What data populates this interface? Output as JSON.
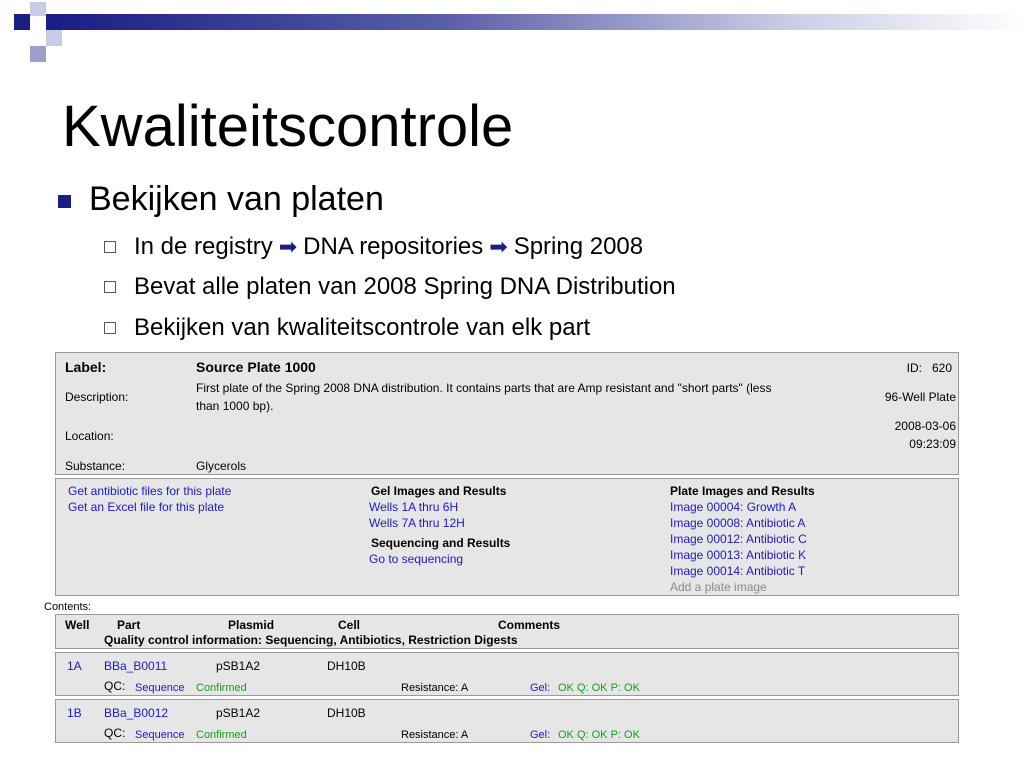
{
  "slide": {
    "title": "Kwaliteitscontrole",
    "bullet1": "Bekijken van platen",
    "sub1": {
      "part1": "In de registry",
      "part2": "DNA repositories",
      "part3": "Spring 2008"
    },
    "sub2": "Bevat alle platen van 2008 Spring DNA Distribution",
    "sub3": "Bekijken van kwaliteitscontrole van elk part",
    "arrow": "➡"
  },
  "plate": {
    "label_key": "Label:",
    "label_value": "Source Plate 1000",
    "id_text": "ID:   620",
    "description_key": "Description:",
    "description_line1": "First plate of the Spring 2008 DNA distribution. It contains parts that are Amp resistant and \"short parts\" (less",
    "description_line2": "than 1000 bp).",
    "plate_type": "96-Well Plate",
    "location_key": "Location:",
    "date": "2008-03-06",
    "time": "09:23:09",
    "substance_key": "Substance:",
    "substance_value": "Glycerols"
  },
  "files": {
    "antibiotic_link": "Get antibiotic files for this plate",
    "excel_link": "Get an Excel file for this plate",
    "gel_heading": "Gel Images and Results",
    "gel_links": [
      "Wells 1A thru 6H",
      "Wells 7A thru 12H"
    ],
    "seq_heading": "Sequencing and Results",
    "seq_link": "Go to sequencing",
    "img_heading": "Plate Images and Results",
    "img_links": [
      "Image 00004: Growth A",
      "Image 00008: Antibiotic A",
      "Image 00012: Antibiotic C",
      "Image 00013: Antibiotic K",
      "Image 00014: Antibiotic T"
    ],
    "add_image": "Add a plate image"
  },
  "contents": {
    "label": "Contents:",
    "headers": {
      "well": "Well",
      "part": "Part",
      "plasmid": "Plasmid",
      "cell": "Cell",
      "comments": "Comments"
    },
    "qc_header": "Quality control information: Sequencing, Antibiotics, Restriction Digests",
    "rows": [
      {
        "well": "1A",
        "part": "BBa_B0011",
        "plasmid": "pSB1A2",
        "cell": "DH10B",
        "qc": "QC:",
        "seq": "Sequence",
        "confirmed": "Confirmed",
        "resistance": "Resistance: A",
        "gel": "Gel:",
        "gel_result": "OK Q: OK P: OK"
      },
      {
        "well": "1B",
        "part": "BBa_B0012",
        "plasmid": "pSB1A2",
        "cell": "DH10B",
        "qc": "QC:",
        "seq": "Sequence",
        "confirmed": "Confirmed",
        "resistance": "Resistance: A",
        "gel": "Gel:",
        "gel_result": "OK Q: OK P: OK"
      }
    ]
  },
  "colors": {
    "accent": "#1a1f85",
    "link": "#1a1acc",
    "ok": "#1a9d1a"
  }
}
